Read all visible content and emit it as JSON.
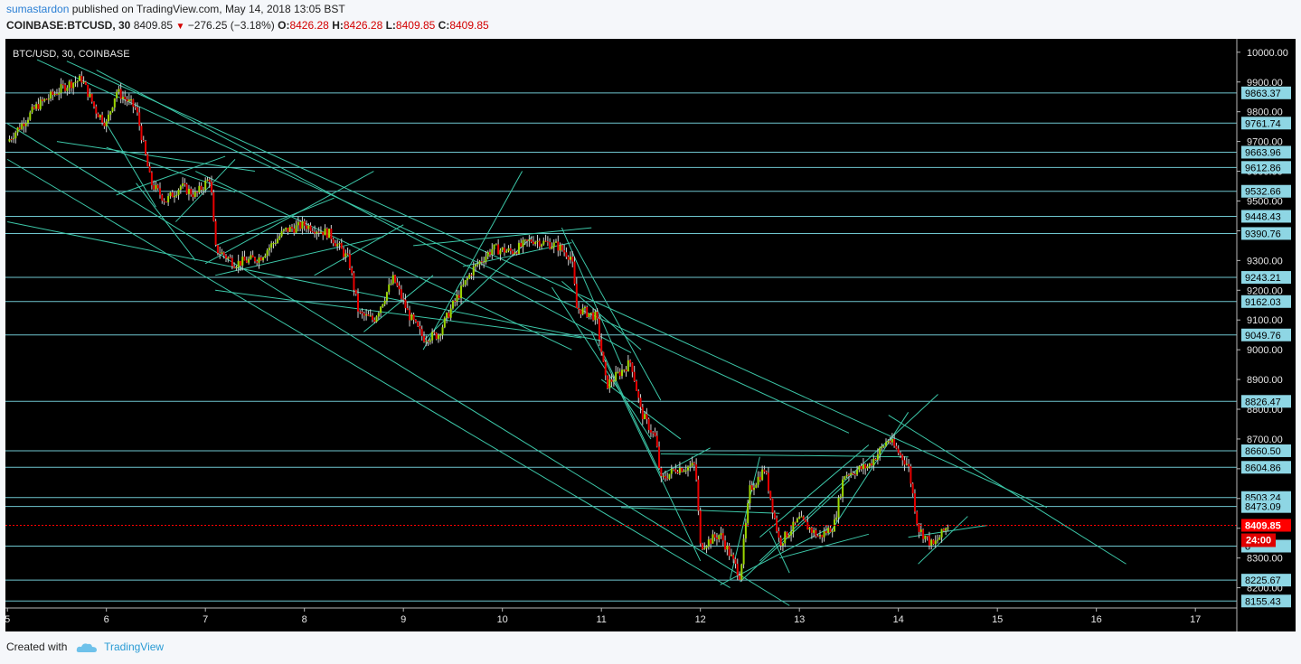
{
  "header": {
    "author": "sumastardon",
    "published_text": "published on TradingView.com, May 14, 2018 13:05 BST",
    "symbol": "COINBASE:BTCUSD, 30",
    "last": "8409.85",
    "change": "−276.25 (−3.18%)",
    "o_label": "O:",
    "o_value": "8426.28",
    "h_label": "H:",
    "h_value": "8426.28",
    "l_label": "L:",
    "l_value": "8409.85",
    "c_label": "C:",
    "c_value": "8409.85"
  },
  "footer": {
    "created_with": "Created with",
    "brand": "TradingView"
  },
  "colors": {
    "up": "#9cd600",
    "down": "#e80000",
    "line": "#3cc7a8",
    "level": "#6fc6cf",
    "label_bg": "#8ed6e4",
    "current": "#ff0000"
  },
  "chart_data": {
    "type": "candlestick",
    "title": "BTC/USD, 30, COINBASE",
    "ylim": [
      8132,
      10045
    ],
    "xlim": [
      4.98,
      17.5
    ],
    "y_ticks": [
      "10000.00",
      "9900.00",
      "9800.00",
      "9700.00",
      "9600.00",
      "9500.00",
      "9400.00",
      "9300.00",
      "9200.00",
      "9100.00",
      "9000.00",
      "8900.00",
      "8800.00",
      "8700.00",
      "8600.00",
      "8500.00",
      "8400.00",
      "8300.00",
      "8200.00"
    ],
    "x_ticks": [
      "5",
      "6",
      "7",
      "8",
      "9",
      "10",
      "11",
      "12",
      "13",
      "14",
      "15",
      "16",
      "17"
    ],
    "horizontal_levels": [
      9863.37,
      9761.74,
      9663.96,
      9612.86,
      9532.66,
      9448.43,
      9390.76,
      9243.21,
      9162.03,
      9049.76,
      8826.47,
      8660.5,
      8604.86,
      8503.24,
      8473.09,
      8340,
      8225.67,
      8155.43
    ],
    "level_labels": [
      "9863.37",
      "9761.74",
      "9663.96",
      "9612.86",
      "9532.66",
      "9448.43",
      "9390.76",
      "9243.21",
      "9162.03",
      "9049.76",
      "8826.47",
      "8660.50",
      "8604.86",
      "8503.24",
      "8473.09",
      "8",
      "8225.67",
      "8155.43"
    ],
    "current_price": 8409.85,
    "current_price_label": "8409.85",
    "countdown": "24:00",
    "price_path": [
      [
        5.0,
        9700
      ],
      [
        5.3,
        9820
      ],
      [
        5.6,
        9890
      ],
      [
        5.75,
        9910
      ],
      [
        5.9,
        9800
      ],
      [
        6.0,
        9760
      ],
      [
        6.1,
        9870
      ],
      [
        6.3,
        9810
      ],
      [
        6.45,
        9560
      ],
      [
        6.6,
        9500
      ],
      [
        6.75,
        9550
      ],
      [
        6.9,
        9520
      ],
      [
        7.05,
        9580
      ],
      [
        7.1,
        9340
      ],
      [
        7.3,
        9290
      ],
      [
        7.55,
        9310
      ],
      [
        7.8,
        9400
      ],
      [
        8.0,
        9420
      ],
      [
        8.25,
        9390
      ],
      [
        8.45,
        9300
      ],
      [
        8.55,
        9120
      ],
      [
        8.7,
        9100
      ],
      [
        8.9,
        9240
      ],
      [
        9.05,
        9120
      ],
      [
        9.2,
        9040
      ],
      [
        9.35,
        9050
      ],
      [
        9.5,
        9150
      ],
      [
        9.7,
        9270
      ],
      [
        9.9,
        9340
      ],
      [
        10.1,
        9330
      ],
      [
        10.3,
        9370
      ],
      [
        10.55,
        9350
      ],
      [
        10.7,
        9310
      ],
      [
        10.75,
        9140
      ],
      [
        10.95,
        9110
      ],
      [
        11.05,
        8880
      ],
      [
        11.3,
        8960
      ],
      [
        11.4,
        8790
      ],
      [
        11.55,
        8700
      ],
      [
        11.6,
        8560
      ],
      [
        11.75,
        8600
      ],
      [
        11.95,
        8610
      ],
      [
        12.0,
        8340
      ],
      [
        12.2,
        8380
      ],
      [
        12.4,
        8240
      ],
      [
        12.5,
        8530
      ],
      [
        12.65,
        8600
      ],
      [
        12.8,
        8350
      ],
      [
        13.0,
        8430
      ],
      [
        13.2,
        8370
      ],
      [
        13.35,
        8410
      ],
      [
        13.45,
        8580
      ],
      [
        13.7,
        8610
      ],
      [
        13.9,
        8700
      ],
      [
        14.1,
        8610
      ],
      [
        14.2,
        8400
      ],
      [
        14.35,
        8340
      ],
      [
        14.5,
        8409.85
      ]
    ]
  }
}
